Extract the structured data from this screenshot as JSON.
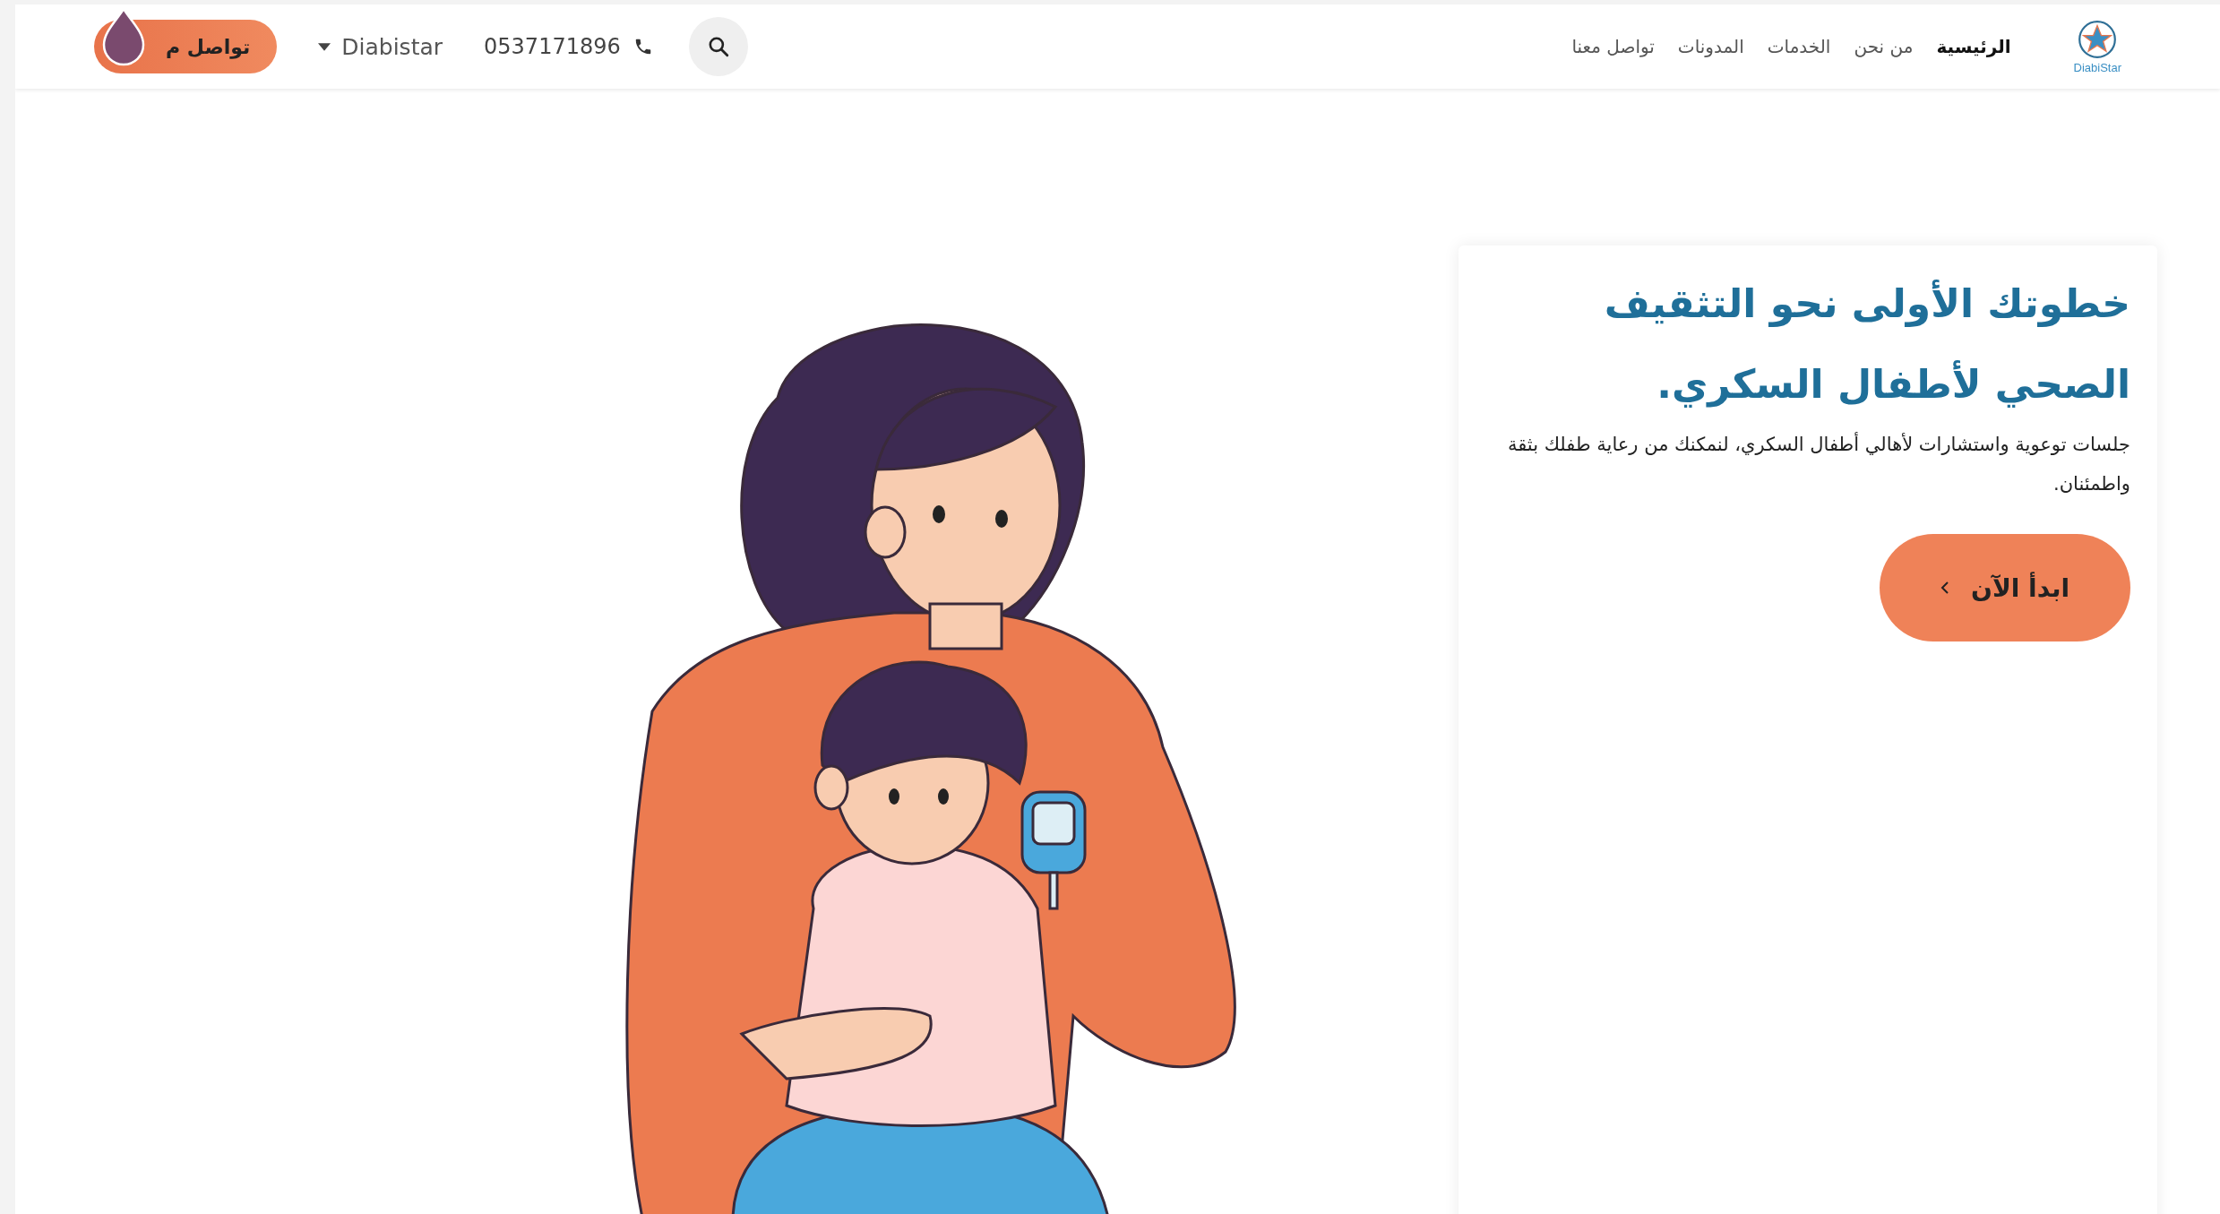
{
  "header": {
    "logo": {
      "text": "DiabiStar"
    },
    "nav": [
      {
        "label": "الرئيسية",
        "selected": true
      },
      {
        "label": "من نحن",
        "selected": false
      },
      {
        "label": "الخدمات",
        "selected": false
      },
      {
        "label": "المدونات",
        "selected": false
      },
      {
        "label": "تواصل معنا",
        "selected": false
      }
    ],
    "phone": "0537171896",
    "menu": {
      "label": "Diabistar"
    },
    "contact_button": {
      "label": "تواصل م"
    }
  },
  "hero": {
    "title": "خطوتك الأولى نحو التثقيف الصحي لأطفال السكري.",
    "description": "جلسات توعوية واستشارات لأهالي أطفال السكري، لنمكنك من رعاية طفلك بثقة واطمئنان.",
    "cta": {
      "label": "ابدأ الآن"
    }
  }
}
